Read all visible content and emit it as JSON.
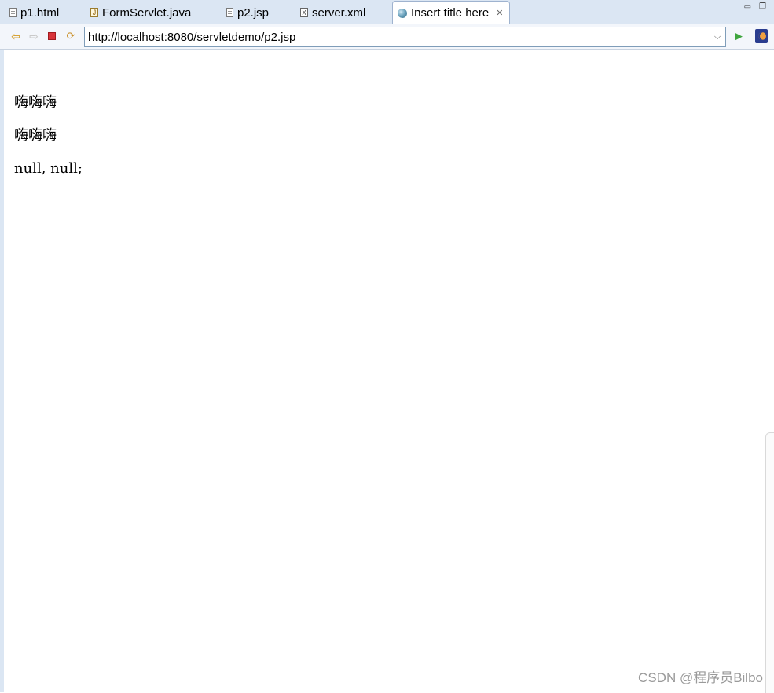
{
  "tabs": [
    {
      "label": "p1.html",
      "icon": "html-file-icon"
    },
    {
      "label": "FormServlet.java",
      "icon": "java-file-icon"
    },
    {
      "label": "p2.jsp",
      "icon": "jsp-file-icon"
    },
    {
      "label": "server.xml",
      "icon": "xml-file-icon"
    },
    {
      "label": "Insert title here",
      "icon": "globe-icon",
      "active": true
    }
  ],
  "window_controls": {
    "minimize": "▭",
    "restore": "🗗"
  },
  "toolbar": {
    "url": "http://localhost:8080/servletdemo/p2.jsp"
  },
  "content": {
    "lines": [
      "嗨嗨嗨",
      "嗨嗨嗨",
      "null, null;"
    ]
  },
  "watermark": "CSDN @程序员Bilbo",
  "colors": {
    "tabbar_bg": "#dbe6f3",
    "stop_red": "#d8343a",
    "go_green": "#3ea53e"
  }
}
